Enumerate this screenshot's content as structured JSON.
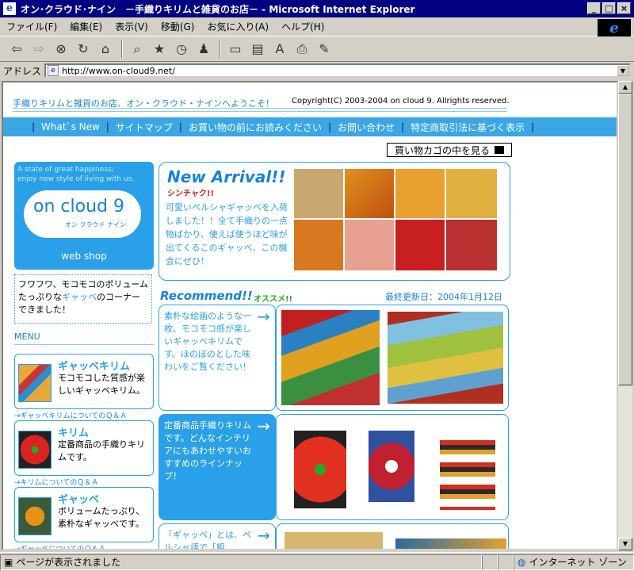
{
  "window": {
    "title": "オン･クラウド･ナイン　－手織りキリムと雑貨のお店－ - Microsoft Internet Explorer",
    "minimize": "_",
    "maximize": "□",
    "close": "×"
  },
  "menu": [
    "ファイル(F)",
    "編集(E)",
    "表示(V)",
    "移動(G)",
    "お気に入り(A)",
    "ヘルプ(H)"
  ],
  "address": {
    "label": "アドレス",
    "url": "http://www.on-cloud9.net/"
  },
  "page": {
    "welcome": "手織りキリムと雑貨のお店、オン・クラウド・ナインへようこそ！",
    "copyright": "Copyright(C) 2003-2004 on cloud 9. Allrights reserved.",
    "nav": [
      "What`s New",
      "サイトマップ",
      "お買い物の前にお読みください",
      "お問い合わせ",
      "特定商取引法に基づく表示"
    ],
    "cart_button": "買い物カゴの中を見る",
    "logo": {
      "tagline1": "A state of great happiness;",
      "tagline2": "enjoy new style of living with us.",
      "name": "on cloud 9",
      "sub": "オン クラウド ナイン",
      "shop": "web shop"
    },
    "note": {
      "line1": "フワフワ、モコモコのボリューム",
      "line2a": "たっぷりな",
      "line2b": "ギャッベ",
      "line2c": "のコーナー",
      "line3": "できました！"
    },
    "menu_label": "MENU",
    "menu_items": [
      {
        "title": "ギャッベキリム",
        "desc": "モコモコした質感が楽しいギャッベキリム。",
        "qa": "→ギャッベキリムについてのＱ＆Ａ"
      },
      {
        "title": "キリム",
        "desc": "定番商品の手織りキリムです。",
        "qa": "→キリムについてのＱ＆Ａ"
      },
      {
        "title": "ギャッベ",
        "desc": "ボリュームたっぷり、素朴なギャッベです。",
        "qa": "→ギャッベについてのＱ＆Ａ"
      }
    ],
    "new_arrival": {
      "title": "New Arrival!!",
      "sub": "シンチャク!!",
      "desc": "可愛いペルシャギャッベを入荷しました！！全て手織りの一点物ばかり、使えば使うほど味が出てくるこのギャッベ、この機会にぜひ！"
    },
    "recommend": {
      "title": "Recommend!!",
      "sub": "オススメ!!",
      "updated": "最終更新日：2004年1月12日"
    },
    "rec_items": [
      {
        "desc": "素朴な絵画のような一枚、モコモコ感が楽しいギャッベキリムです。ほのぼのとした味わいをご覧ください！"
      },
      {
        "desc": "定番商品手織りキリムです。どんなインテリアにもあわせやすいおすすめのラインナップ！"
      },
      {
        "desc": "「ギャッベ」とは、ペルシャ語で「粗"
      }
    ]
  },
  "status": {
    "text": "ページが表示されました",
    "zone": "インターネット ゾーン"
  },
  "colors": {
    "accent": "#2aa0e8",
    "nav_bg": "#3aa6e6",
    "title_bar": "#000080"
  }
}
